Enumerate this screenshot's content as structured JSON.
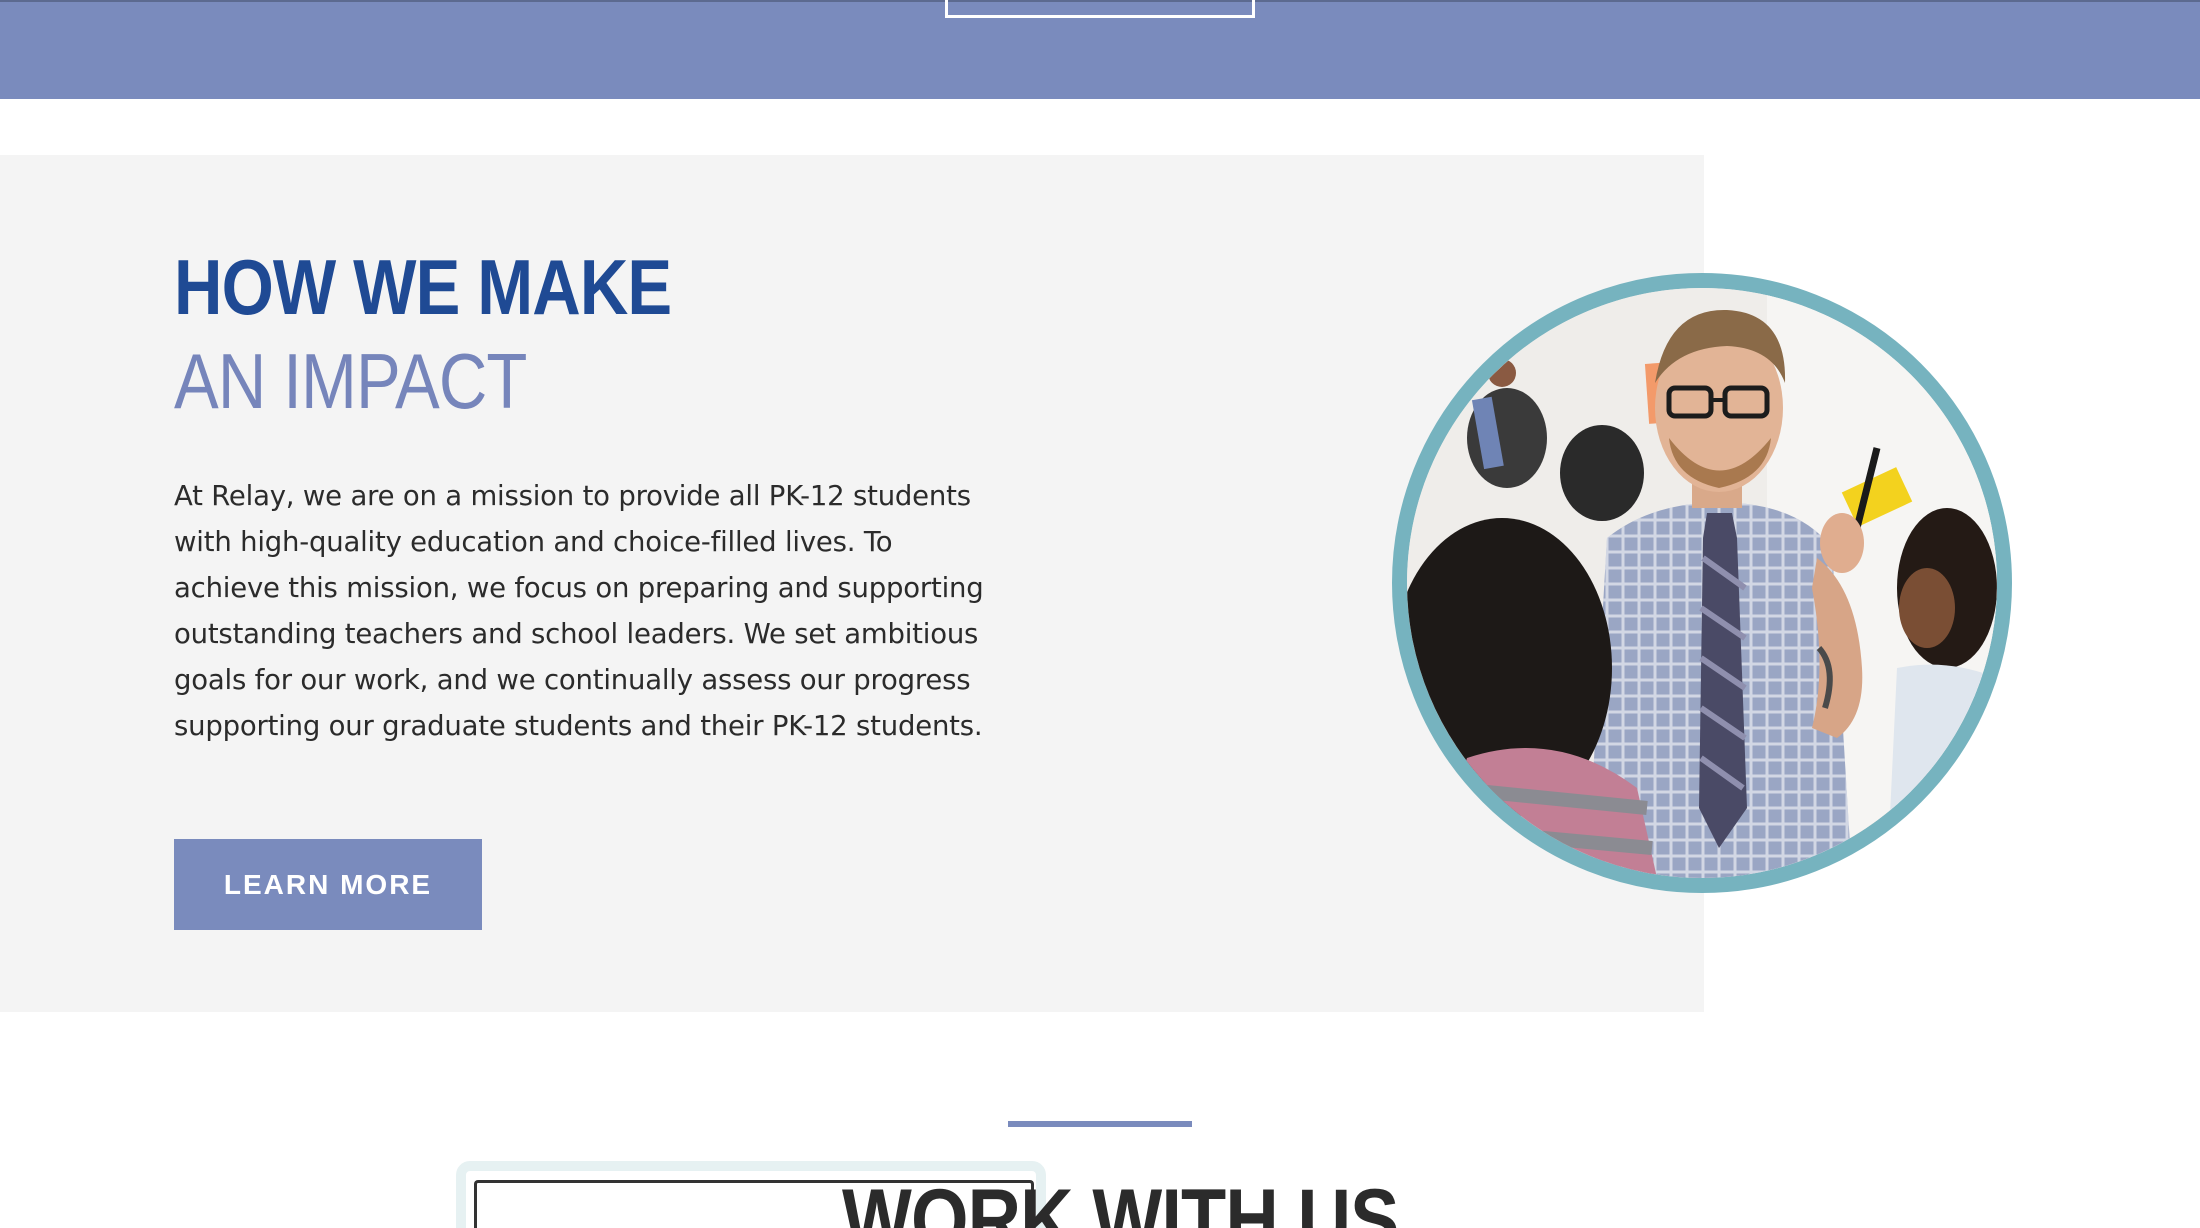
{
  "banner": {
    "color": "#7a8bbd"
  },
  "impact": {
    "heading_line1": "HOW WE MAKE",
    "heading_line2": "AN IMPACT",
    "body": "At Relay, we are on a mission to provide all PK-12 students with high-quality education and choice-filled lives. To achieve this mission, we focus on preparing and supporting outstanding teachers and school leaders. We set ambitious goals for our work, and we continually assess our progress supporting our graduate students and their PK-12 students.",
    "button_label": "LEARN MORE",
    "photo_icon": "classroom-teacher-photo",
    "colors": {
      "heading_primary": "#1f4a94",
      "heading_secondary": "#7685bb",
      "button": "#7a8bbd",
      "photo_border": "#76b3bf",
      "panel": "#f4f4f4"
    }
  },
  "work": {
    "heading": "WORK WITH US"
  }
}
